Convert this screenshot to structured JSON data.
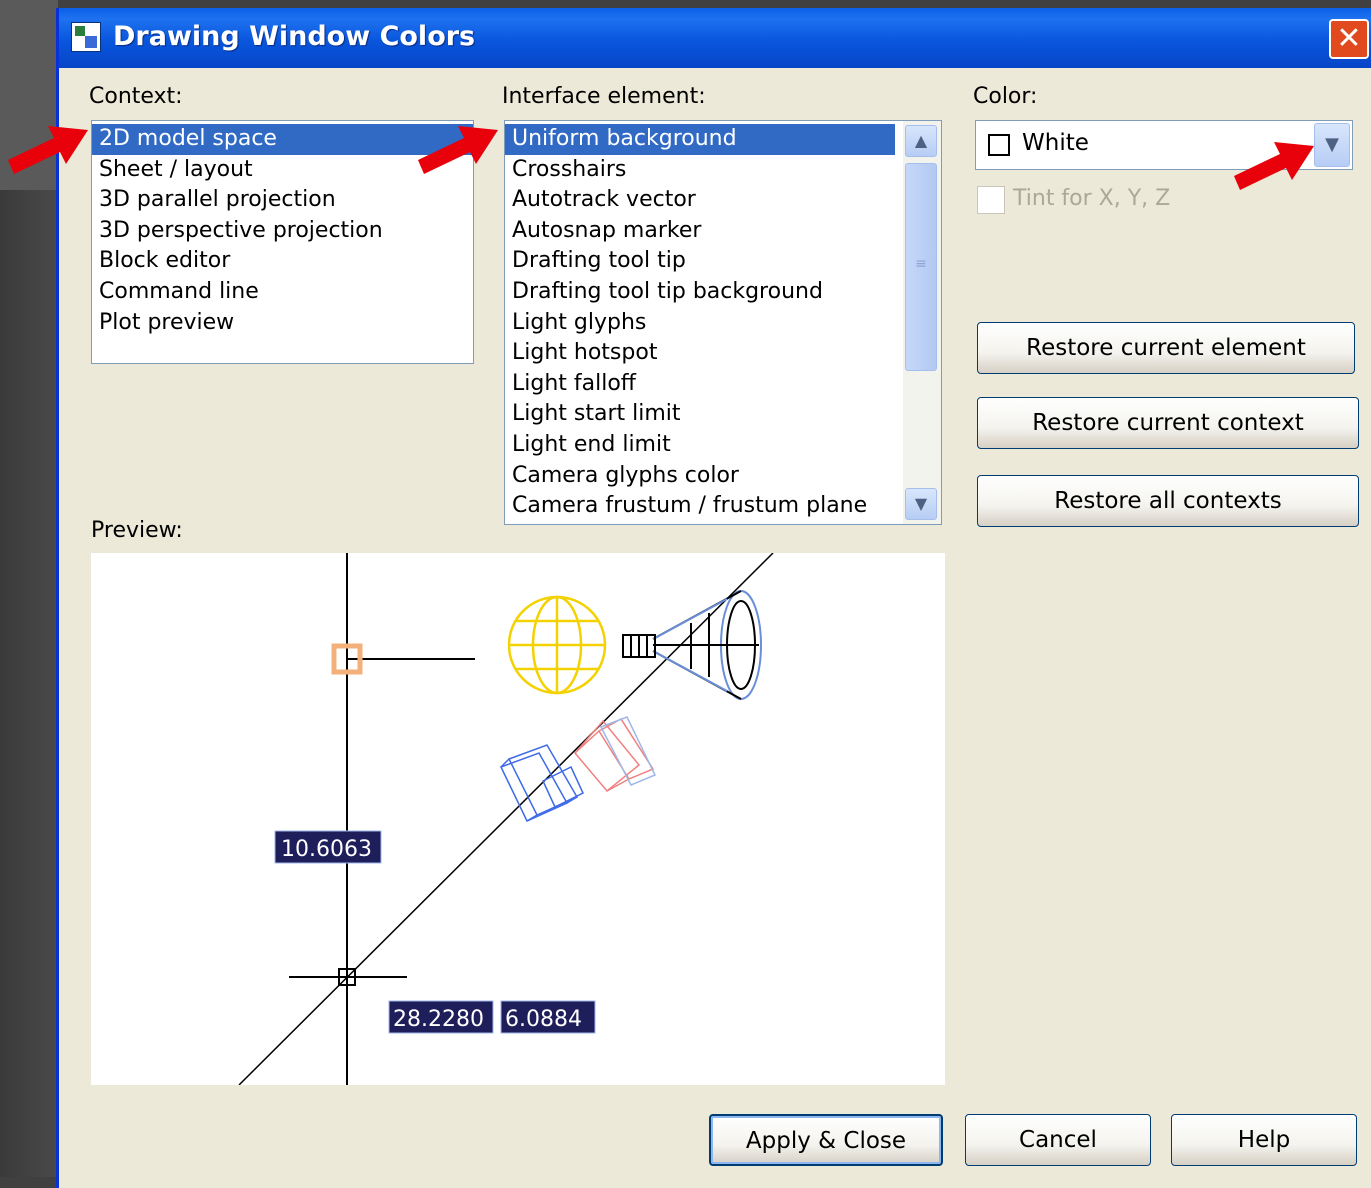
{
  "window": {
    "title": "Drawing Window Colors"
  },
  "context": {
    "label": "Context:",
    "items": [
      "2D model space",
      "Sheet / layout",
      "3D parallel projection",
      "3D perspective projection",
      "Block editor",
      "Command line",
      "Plot preview"
    ],
    "selected": "2D model space"
  },
  "interface_element": {
    "label": "Interface element:",
    "items": [
      "Uniform background",
      "Crosshairs",
      "Autotrack vector",
      "Autosnap marker",
      "Drafting tool tip",
      "Drafting tool tip background",
      "Light glyphs",
      "Light hotspot",
      "Light falloff",
      "Light start limit",
      "Light end limit",
      "Camera glyphs color",
      "Camera frustum / frustum plane"
    ],
    "selected": "Uniform background"
  },
  "color": {
    "label": "Color:",
    "value": "White",
    "tint_label": "Tint for X, Y, Z",
    "tint_checked": false,
    "tint_enabled": false
  },
  "restore": {
    "element": "Restore current element",
    "context": "Restore current context",
    "all": "Restore all contexts"
  },
  "preview": {
    "label": "Preview:",
    "tooltip_length": "10.6063",
    "tooltip_x": "28.2280",
    "tooltip_y": "6.0884"
  },
  "buttons": {
    "apply": "Apply & Close",
    "cancel": "Cancel",
    "help": "Help"
  },
  "colors": {
    "titlebar": "#0A5FE8",
    "selection": "#316AC5",
    "annotation_arrow": "#E8000B",
    "tooltip_bg": "#1E1E5A"
  }
}
